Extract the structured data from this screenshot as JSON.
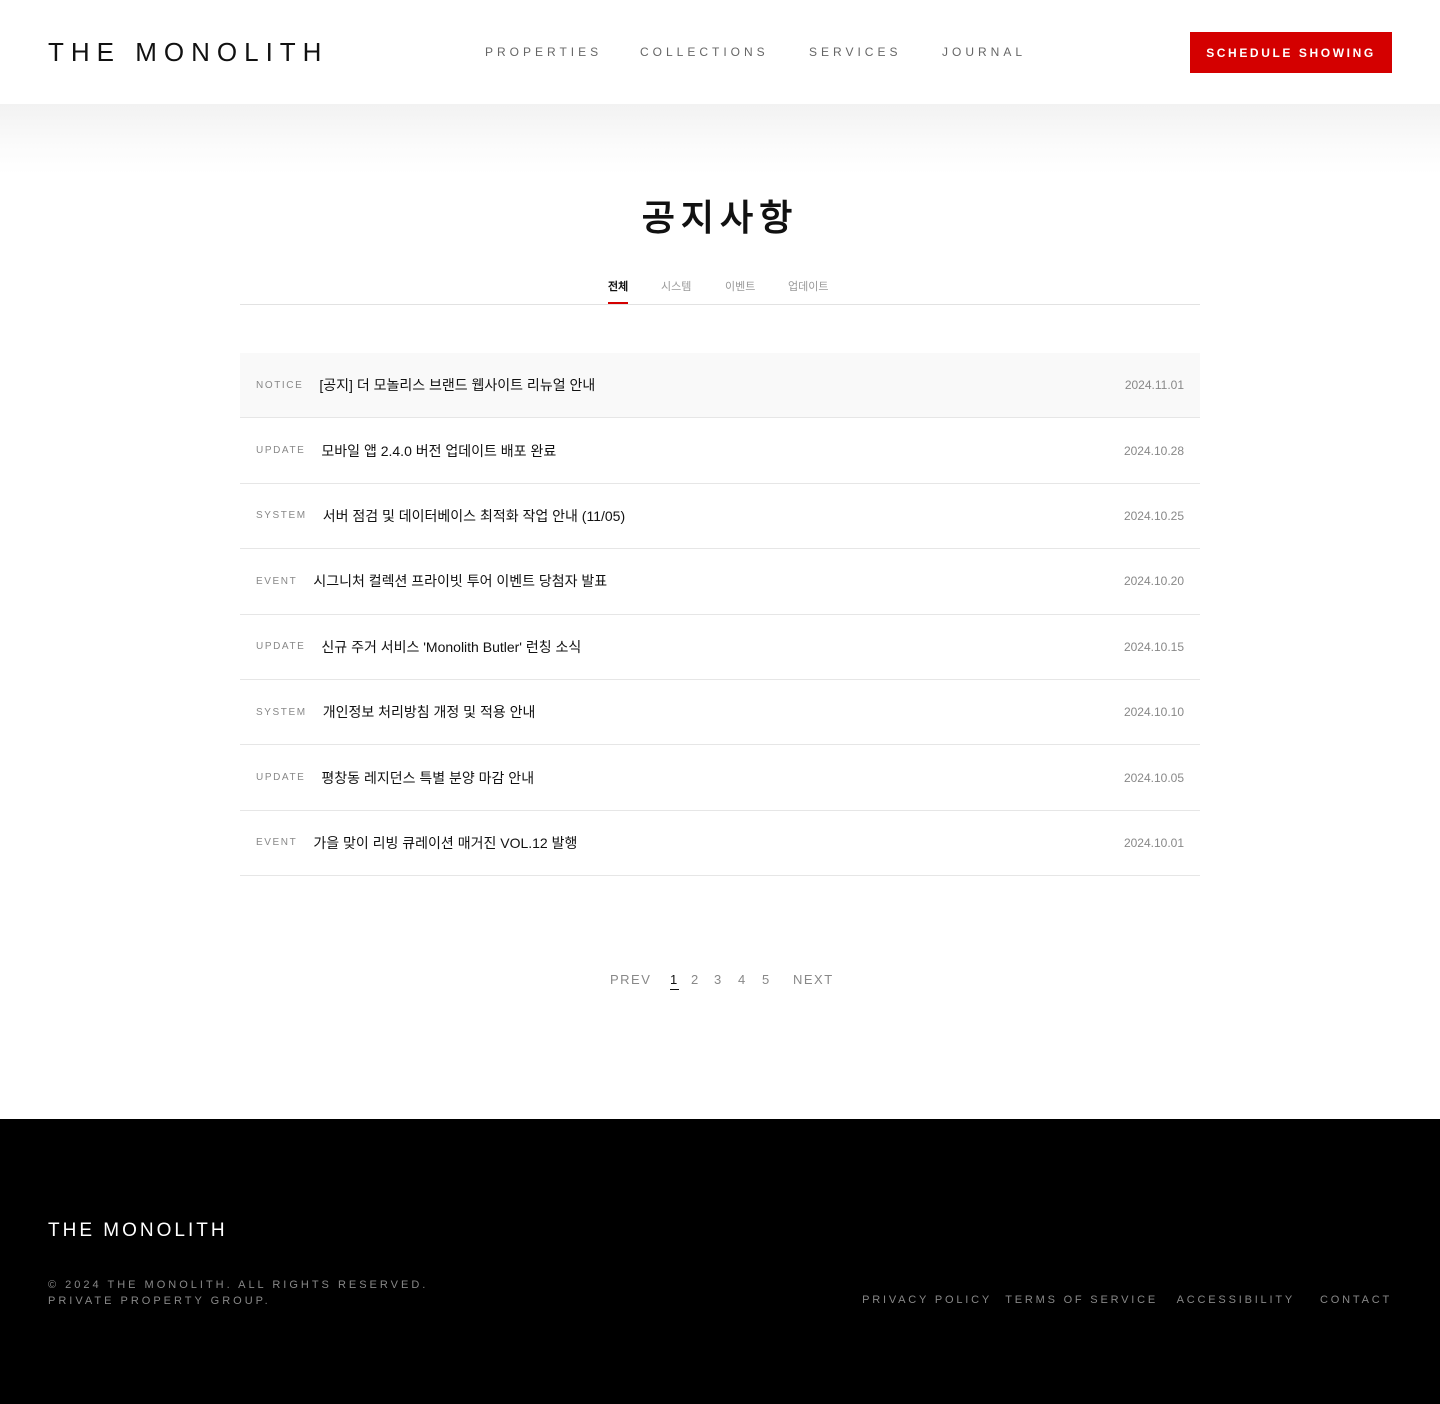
{
  "header": {
    "logo": "THE MONOLITH",
    "nav": [
      "PROPERTIES",
      "COLLECTIONS",
      "SERVICES",
      "JOURNAL"
    ],
    "cta": "SCHEDULE SHOWING"
  },
  "page": {
    "title": "공지사항"
  },
  "tabs": [
    {
      "label": "전체",
      "active": true
    },
    {
      "label": "시스템",
      "active": false
    },
    {
      "label": "이벤트",
      "active": false
    },
    {
      "label": "업데이트",
      "active": false
    }
  ],
  "notices": [
    {
      "category": "NOTICE",
      "subject": "[공지] 더 모놀리스 브랜드 웹사이트 리뉴얼 안내",
      "date": "2024.11.01"
    },
    {
      "category": "UPDATE",
      "subject": "모바일 앱 2.4.0 버전 업데이트 배포 완료",
      "date": "2024.10.28"
    },
    {
      "category": "SYSTEM",
      "subject": "서버 점검 및 데이터베이스 최적화 작업 안내 (11/05)",
      "date": "2024.10.25"
    },
    {
      "category": "EVENT",
      "subject": "시그니처 컬렉션 프라이빗 투어 이벤트 당첨자 발표",
      "date": "2024.10.20"
    },
    {
      "category": "UPDATE",
      "subject": "신규 주거 서비스 'Monolith Butler' 런칭 소식",
      "date": "2024.10.15"
    },
    {
      "category": "SYSTEM",
      "subject": "개인정보 처리방침 개정 및 적용 안내",
      "date": "2024.10.10"
    },
    {
      "category": "UPDATE",
      "subject": "평창동 레지던스 특별 분양 마감 안내",
      "date": "2024.10.05"
    },
    {
      "category": "EVENT",
      "subject": "가을 맞이 리빙 큐레이션 매거진 VOL.12 발행",
      "date": "2024.10.01"
    }
  ],
  "pagination": {
    "prev": "PREV",
    "pages": [
      "1",
      "2",
      "3",
      "4",
      "5"
    ],
    "current": "1",
    "next": "NEXT"
  },
  "footer": {
    "logo": "THE MONOLITH",
    "copyright_line1": "© 2024 THE MONOLITH. ALL RIGHTS RESERVED.",
    "copyright_line2": "PRIVATE PROPERTY GROUP.",
    "links": [
      "PRIVACY POLICY",
      "TERMS OF SERVICE",
      "ACCESSIBILITY",
      "CONTACT"
    ]
  },
  "colors": {
    "accent": "#d40000",
    "footer_bg": "#000000",
    "text": "#111111",
    "muted": "#888888"
  }
}
